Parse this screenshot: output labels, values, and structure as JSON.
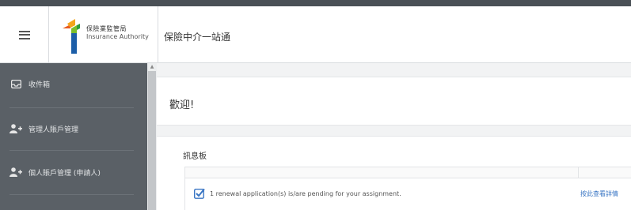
{
  "header": {
    "logo": {
      "name_zh": "保險業監管局",
      "name_en": "Insurance Authority"
    },
    "title": "保險中介一站通"
  },
  "sidebar": {
    "items": [
      {
        "label": "收件箱",
        "icon": "inbox-icon"
      },
      {
        "label": "管理人賬戶管理",
        "icon": "user-plus-icon"
      },
      {
        "label": "個人賬戶管理 (申請人)",
        "icon": "user-plus-icon"
      }
    ]
  },
  "main": {
    "welcome": "歡迎!",
    "board": {
      "title": "訊息板",
      "rows": [
        {
          "message": "1 renewal application(s) is/are pending for your assignment.",
          "link": "按此查看詳情"
        }
      ]
    }
  },
  "colors": {
    "sidebar_bg": "#5a6066",
    "top_strip": "#4a5056",
    "link": "#3a76c4",
    "check": "#3a76c4"
  }
}
